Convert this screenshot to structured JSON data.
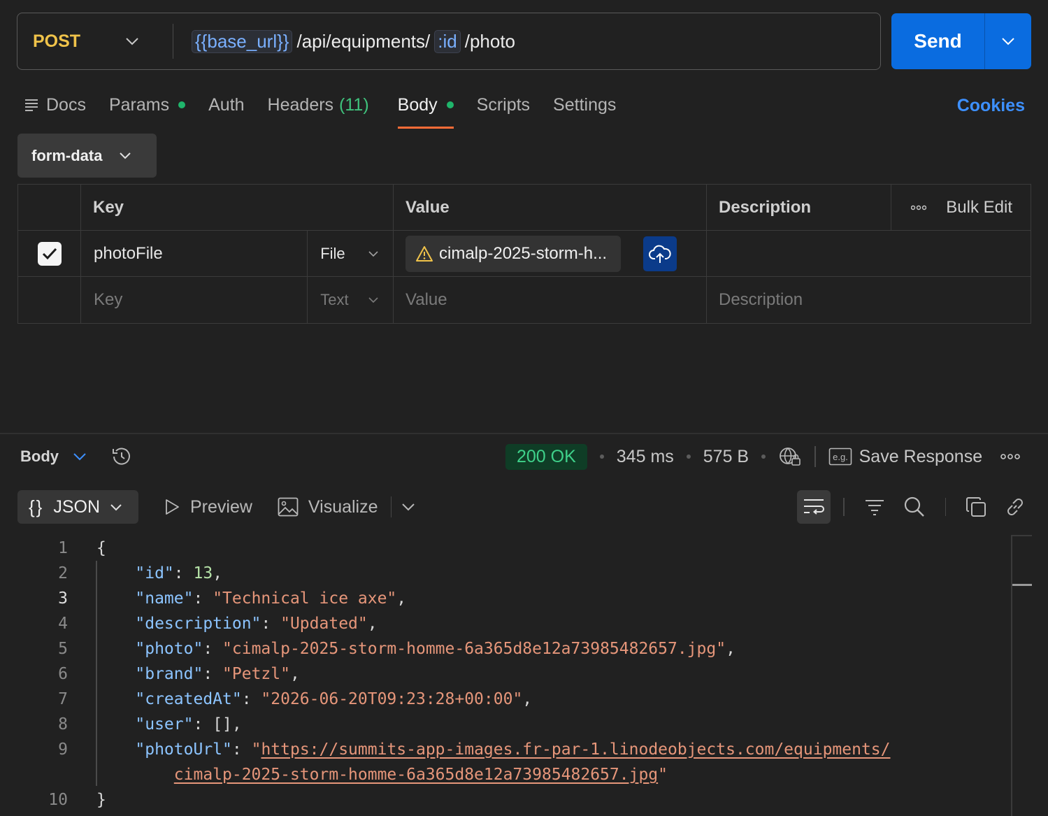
{
  "request": {
    "method": "POST",
    "url_parts": {
      "base_var": "{{base_url}}",
      "path1": "/api/equipments/",
      "id_var": ":id",
      "path2": "/photo"
    },
    "send_label": "Send"
  },
  "tabs": [
    {
      "label": "Docs"
    },
    {
      "label": "Params"
    },
    {
      "label": "Auth"
    },
    {
      "label": "Headers",
      "count": "(11)"
    },
    {
      "label": "Body"
    },
    {
      "label": "Scripts"
    },
    {
      "label": "Settings"
    }
  ],
  "cookies_label": "Cookies",
  "body_mode": "form-data",
  "table": {
    "headers": {
      "key": "Key",
      "value": "Value",
      "description": "Description",
      "bulk_edit": "Bulk Edit"
    },
    "rows": [
      {
        "key": "photoFile",
        "type": "File",
        "value": "cimalp-2025-storm-h...",
        "description": ""
      }
    ],
    "empty_row": {
      "key_placeholder": "Key",
      "type": "Text",
      "value_placeholder": "Value",
      "description_placeholder": "Description"
    }
  },
  "response": {
    "section": "Body",
    "status": "200 OK",
    "time": "345 ms",
    "size": "575 B",
    "save_response": "Save Response",
    "eg_label": "e.g.",
    "format": "JSON",
    "preview": "Preview",
    "visualize": "Visualize"
  },
  "code_lines": [
    {
      "n": "1"
    },
    {
      "n": "2"
    },
    {
      "n": "3"
    },
    {
      "n": "4"
    },
    {
      "n": "5"
    },
    {
      "n": "6"
    },
    {
      "n": "7"
    },
    {
      "n": "8"
    },
    {
      "n": "9"
    },
    {
      "n": ""
    },
    {
      "n": "10"
    }
  ],
  "json_body": {
    "id_key": "\"id\"",
    "id_val": "13",
    "name_key": "\"name\"",
    "name_val": "\"Technical ice axe\"",
    "description_key": "\"description\"",
    "description_val": "\"Updated\"",
    "photo_key": "\"photo\"",
    "photo_val": "\"cimalp-2025-storm-homme-6a365d8e12a73985482657.jpg\"",
    "brand_key": "\"brand\"",
    "brand_val": "\"Petzl\"",
    "createdAt_key": "\"createdAt\"",
    "createdAt_val": "\"2026-06-20T09:23:28+00:00\"",
    "user_key": "\"user\"",
    "user_val": "[]",
    "photoUrl_key": "\"photoUrl\"",
    "photoUrl_val_1": "https://summits-app-images.fr-par-1.linodeobjects.com/equipments/",
    "photoUrl_val_2": "cimalp-2025-storm-homme-6a365d8e12a73985482657.jpg"
  },
  "colors": {
    "accent": "#ff6c37",
    "send": "#0a6ce0",
    "method": "#f0c34a",
    "status_ok": "#3fd18a"
  }
}
